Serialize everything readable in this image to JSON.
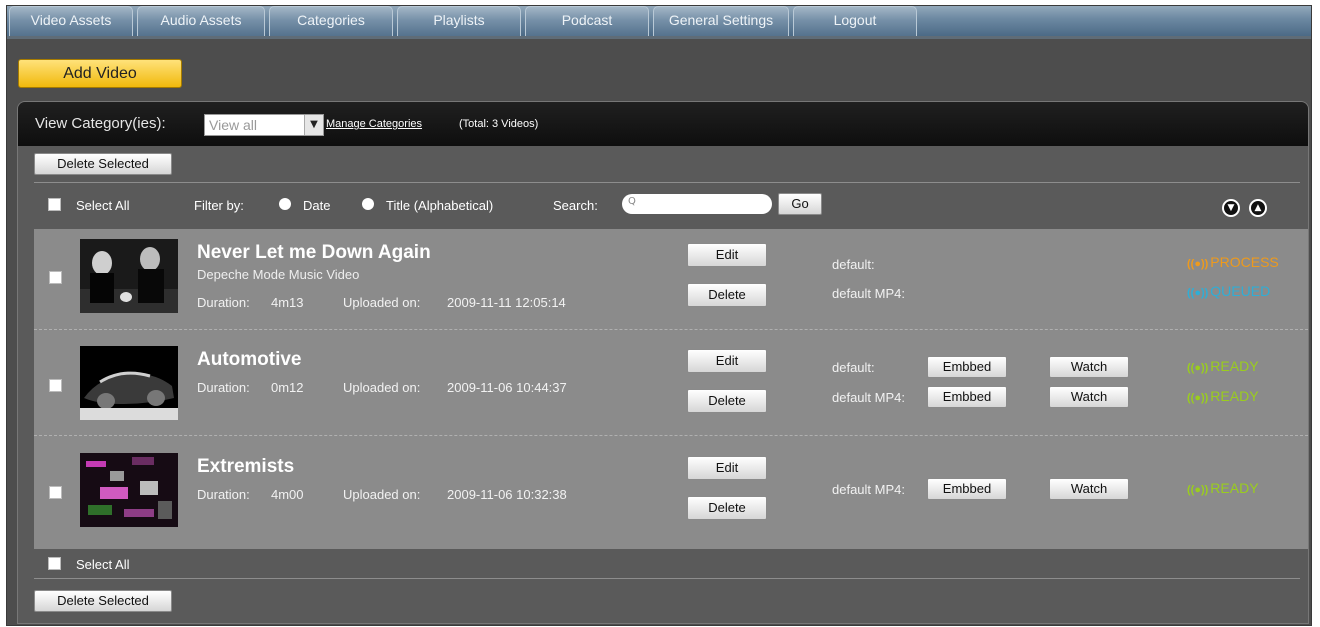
{
  "tabs": [
    "Video Assets",
    "Audio Assets",
    "Categories",
    "Playlists",
    "Podcast",
    "General Settings",
    "Logout"
  ],
  "add_video_label": "Add Video",
  "category_bar": {
    "label": "View Category(ies):",
    "selected": "View all",
    "manage_link": "Manage Categories",
    "total": "(Total: 3 Videos)"
  },
  "delete_selected_label": "Delete Selected",
  "filter_bar": {
    "select_all": "Select All",
    "filter_by": "Filter by:",
    "date": "Date",
    "title_alpha": "Title (Alphabetical)",
    "search_label": "Search:",
    "search_placeholder": "Q",
    "go": "Go"
  },
  "videos": [
    {
      "title": "Never Let me Down Again",
      "subtitle": "Depeche Mode Music Video",
      "duration_label": "Duration:",
      "duration": "4m13",
      "uploaded_label": "Uploaded on:",
      "uploaded": "2009-11-11 12:05:14",
      "edit": "Edit",
      "delete": "Delete",
      "formats": [
        {
          "name": "default:",
          "embed": "",
          "watch": "",
          "status": "PROCESS",
          "status_color": "#ee9a1c"
        },
        {
          "name": "default MP4:",
          "embed": "",
          "watch": "",
          "status": "QUEUED",
          "status_color": "#2eaed6"
        }
      ]
    },
    {
      "title": "Automotive",
      "subtitle": "",
      "duration_label": "Duration:",
      "duration": "0m12",
      "uploaded_label": "Uploaded on:",
      "uploaded": "2009-11-06 10:44:37",
      "edit": "Edit",
      "delete": "Delete",
      "formats": [
        {
          "name": "default:",
          "embed": "Embbed",
          "watch": "Watch",
          "status": "READY",
          "status_color": "#9acd1e"
        },
        {
          "name": "default MP4:",
          "embed": "Embbed",
          "watch": "Watch",
          "status": "READY",
          "status_color": "#9acd1e"
        }
      ]
    },
    {
      "title": "Extremists",
      "subtitle": "",
      "duration_label": "Duration:",
      "duration": "4m00",
      "uploaded_label": "Uploaded on:",
      "uploaded": "2009-11-06 10:32:38",
      "edit": "Edit",
      "delete": "Delete",
      "formats": [
        {
          "name": "default MP4:",
          "embed": "Embbed",
          "watch": "Watch",
          "status": "READY",
          "status_color": "#9acd1e"
        }
      ]
    }
  ],
  "colors": {
    "accent_button": "#f1b90c",
    "tab_blue": "#6e8aa3",
    "ready": "#9acd1e",
    "processing": "#ee9a1c",
    "queued": "#2eaed6"
  },
  "icons": {
    "sort_down": "circle-down-arrow-icon",
    "sort_up": "circle-up-arrow-icon",
    "signal": "broadcast-signal-icon"
  }
}
